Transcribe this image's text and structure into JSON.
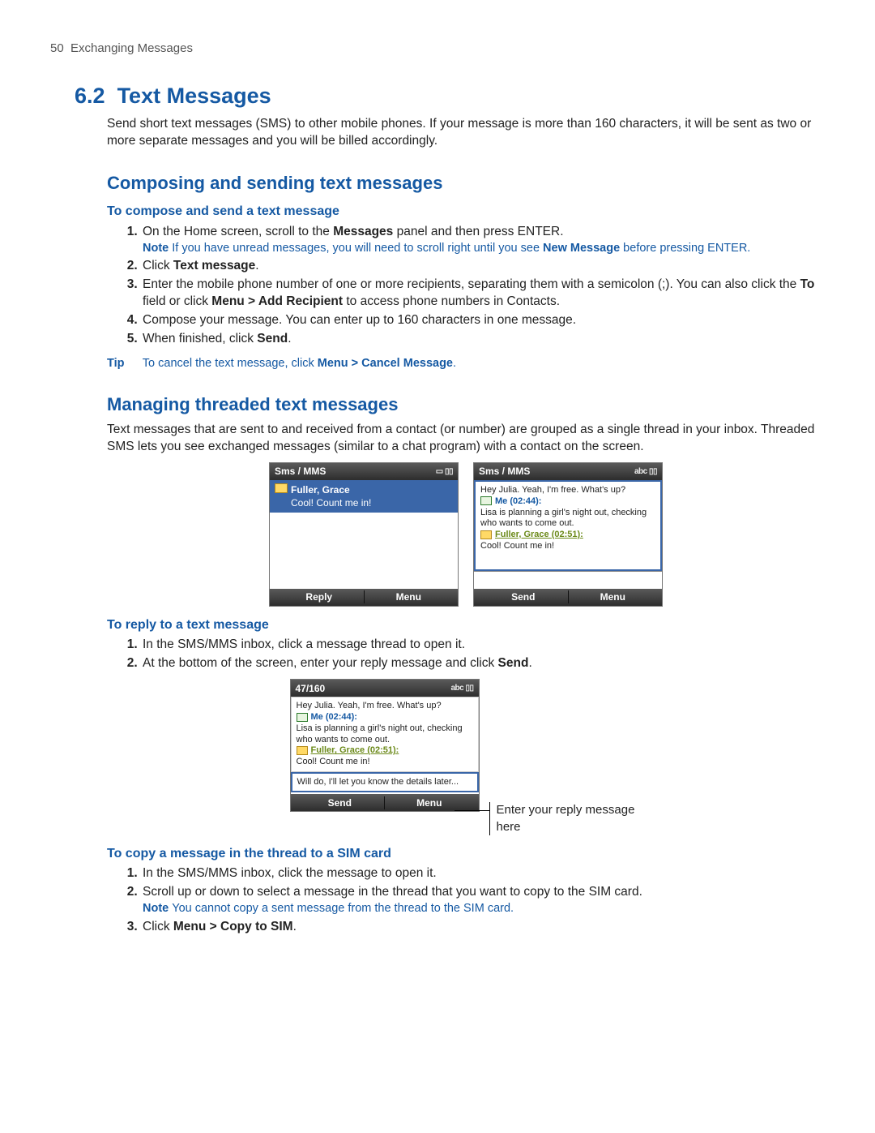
{
  "header": {
    "page_number": "50",
    "chapter": "Exchanging Messages"
  },
  "section": {
    "number": "6.2",
    "title": "Text Messages",
    "intro": "Send short text messages (SMS) to other mobile phones. If your message is more than 160 characters, it will be sent as two or more separate messages and you will be billed accordingly."
  },
  "composing": {
    "heading": "Composing and sending text messages",
    "task_heading": "To compose and send a text message",
    "step1_a": "On the Home screen, scroll to the ",
    "step1_bold": "Messages",
    "step1_b": " panel and then press ENTER.",
    "note1_label": "Note",
    "note1_a": "If you have unread messages, you will need to scroll right until you see ",
    "note1_bold": "New Message",
    "note1_b": " before pressing ENTER.",
    "step2_a": "Click ",
    "step2_bold": "Text message",
    "step2_b": ".",
    "step3_a": "Enter the mobile phone number of one or more recipients, separating them with a semicolon (;). You can also click the ",
    "step3_bold1": "To",
    "step3_mid": " field or click ",
    "step3_bold2": "Menu > Add Recipient",
    "step3_b": " to access phone numbers in Contacts.",
    "step4": "Compose your message. You can enter up to 160 characters in one message.",
    "step5_a": "When finished, click ",
    "step5_bold": "Send",
    "step5_b": ".",
    "tip_label": "Tip",
    "tip_a": "To cancel the text message, click ",
    "tip_bold": "Menu > Cancel Message",
    "tip_b": "."
  },
  "managing": {
    "heading": "Managing threaded text messages",
    "intro": "Text messages that are sent to and received from a contact (or number) are grouped as a single thread in your inbox. Threaded SMS lets you see exchanged messages (similar to a chat program) with a contact on the screen."
  },
  "screens": {
    "left": {
      "title": "Sms / MMS",
      "status": "▭ ▯▯",
      "row_name": "Fuller, Grace",
      "row_preview": "Cool! Count me in!",
      "soft_left": "Reply",
      "soft_right": "Menu"
    },
    "right": {
      "title": "Sms / MMS",
      "status": "abc ▯▯",
      "line1": "Hey Julia. Yeah, I'm free. What's up?",
      "me_label": "Me (02:44):",
      "me_text": "Lisa is planning a girl's night out, checking who wants to come out.",
      "other_label": "Fuller, Grace (02:51):",
      "other_text": "Cool! Count me in!",
      "compose_placeholder": "",
      "soft_left": "Send",
      "soft_right": "Menu"
    },
    "reply": {
      "title": "47/160",
      "status": "abc ▯▯",
      "line1": "Hey Julia. Yeah, I'm free. What's up?",
      "me_label": "Me (02:44):",
      "me_text": "Lisa is planning a girl's night out, checking who wants to come out.",
      "other_label": "Fuller, Grace (02:51):",
      "other_text": "Cool! Count me in!",
      "compose_text": "Will do, I'll let you know the details later...",
      "soft_left": "Send",
      "soft_right": "Menu",
      "callout": "Enter your reply message here"
    }
  },
  "reply_task": {
    "heading": "To reply to a text message",
    "step1": "In the SMS/MMS inbox, click a message thread to open it.",
    "step2_a": "At the bottom of the screen, enter your reply message and click ",
    "step2_bold": "Send",
    "step2_b": "."
  },
  "copy_task": {
    "heading": "To copy a message in the thread to a SIM card",
    "step1": "In the SMS/MMS inbox, click the message to open it.",
    "step2": "Scroll up or down to select a message in the thread that you want to copy to the SIM card.",
    "note_label": "Note",
    "note_text": "You cannot copy a sent message from the thread to the SIM card.",
    "step3_a": "Click ",
    "step3_bold": "Menu > Copy to SIM",
    "step3_b": "."
  }
}
